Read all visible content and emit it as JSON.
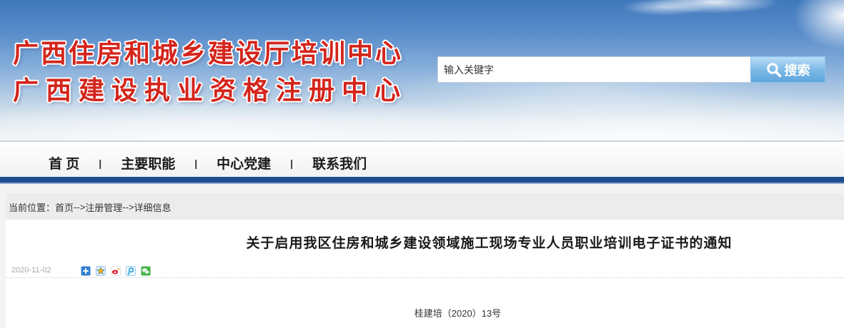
{
  "banner": {
    "title_line1": "广西住房和城乡建设厅培训中心",
    "title_line2": "广西建设执业资格注册中心"
  },
  "search": {
    "value": "输入关键字",
    "button_label": "搜索",
    "button_icon": "search-icon"
  },
  "nav": {
    "items": [
      "首 页",
      "主要职能",
      "中心党建",
      "联系我们"
    ],
    "separator": "|"
  },
  "breadcrumb": {
    "label": "当前位置：",
    "items": [
      "首页",
      "注册管理",
      "详细信息"
    ],
    "separator": "-->"
  },
  "article": {
    "title": "关于启用我区住房和城乡建设领域施工现场专业人员职业培训电子证书的通知",
    "date": "2020-11-02",
    "share_icons": [
      "share-more-icon",
      "qzone-icon",
      "weibo-icon",
      "tencent-weibo-icon",
      "wechat-icon"
    ],
    "doc_number": "桂建培（2020）13号"
  },
  "theme": {
    "title_red": "#d4251c",
    "nav_band": "#1e4c8f",
    "search_button": "#5ea5de"
  }
}
